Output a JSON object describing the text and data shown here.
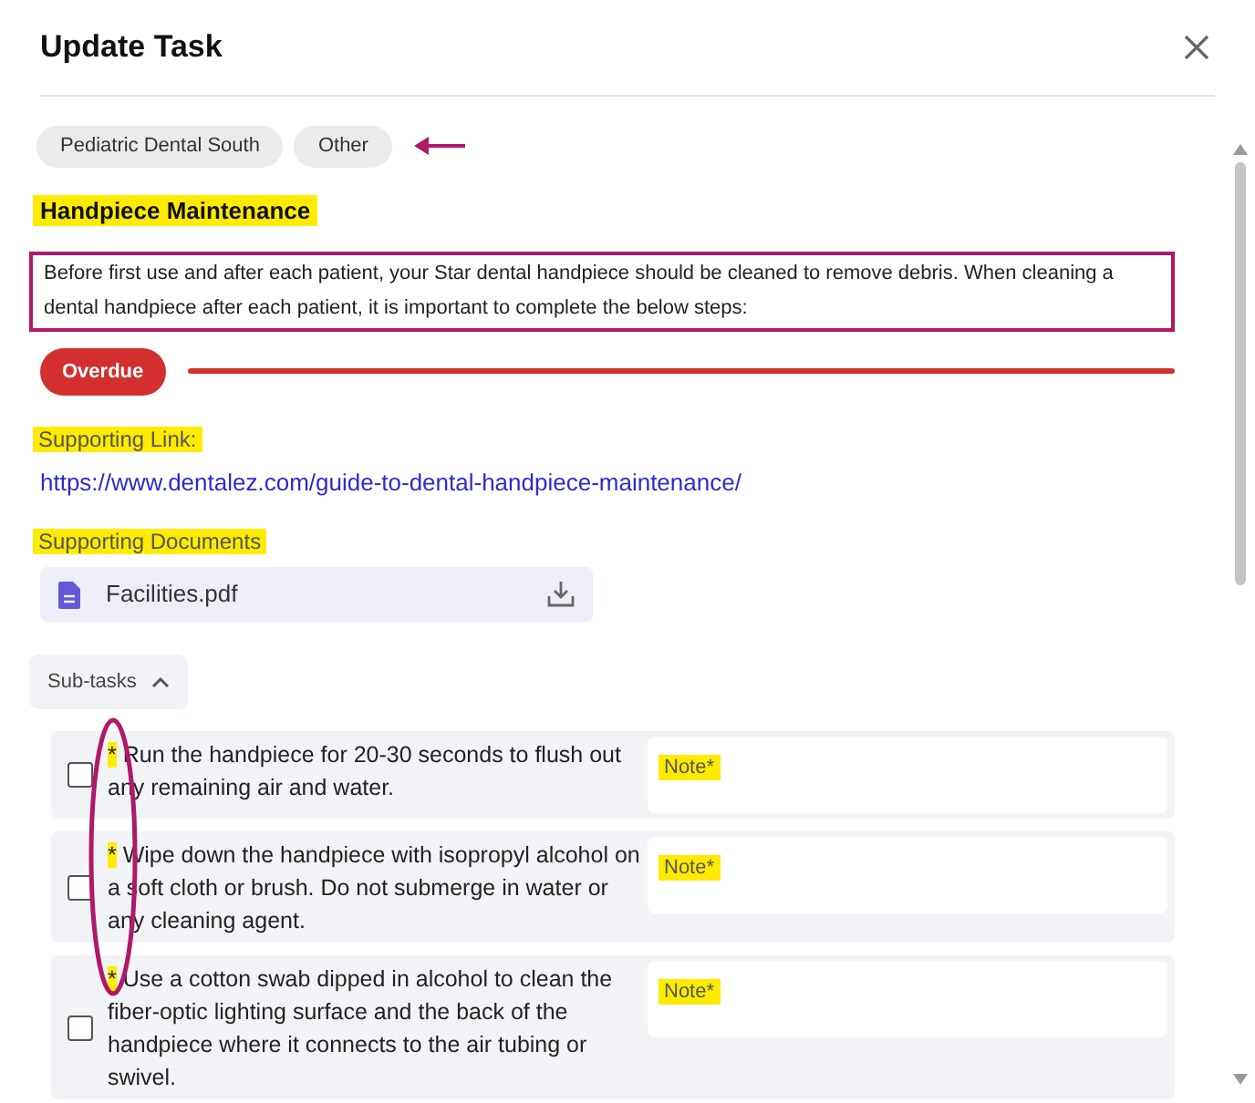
{
  "dialog": {
    "title": "Update Task"
  },
  "tags": [
    {
      "label": "Pediatric Dental South"
    },
    {
      "label": "Other"
    }
  ],
  "task": {
    "title": {
      "text": "Handpiece Maintenance",
      "highlighted": true
    },
    "description": "Before first use and after each patient, your Star dental handpiece should be cleaned to remove debris. When cleaning a dental handpiece after each patient, it is important to complete the below steps:",
    "status": "Overdue"
  },
  "supporting_link": {
    "label": {
      "text": "Supporting Link:",
      "highlighted": true
    },
    "url": "https://www.dentalez.com/guide-to-dental-handpiece-maintenance/"
  },
  "supporting_documents": {
    "label": {
      "text": "Supporting Documents",
      "highlighted": true
    },
    "files": [
      {
        "name": "Facilities.pdf"
      }
    ]
  },
  "subtasks": {
    "label": "Sub-tasks",
    "expanded": true,
    "items": [
      {
        "required_mark": {
          "text": "*",
          "highlighted": true
        },
        "text": "Run the handpiece for 20-30 seconds to flush out any remaining air and water.",
        "checked": false,
        "note_label": {
          "text": "Note*",
          "highlighted": true
        }
      },
      {
        "required_mark": {
          "text": "*",
          "highlighted": true
        },
        "text": "Wipe down the handpiece with isopropyl alcohol on a soft cloth or brush. Do not submerge in water or any cleaning agent.",
        "checked": false,
        "note_label": {
          "text": "Note*",
          "highlighted": true
        }
      },
      {
        "required_mark": {
          "text": "*",
          "highlighted": true
        },
        "text": "Use a cotton swab dipped in alcohol to clean the fiber-optic lighting surface and the back of the handpiece where it connects to the air tubing or swivel.",
        "checked": false,
        "note_label": {
          "text": "Note*",
          "highlighted": true
        }
      }
    ]
  },
  "annotations": [
    {
      "kind": "arrow"
    },
    {
      "kind": "box"
    },
    {
      "kind": "underline"
    },
    {
      "kind": "ellipse"
    }
  ]
}
